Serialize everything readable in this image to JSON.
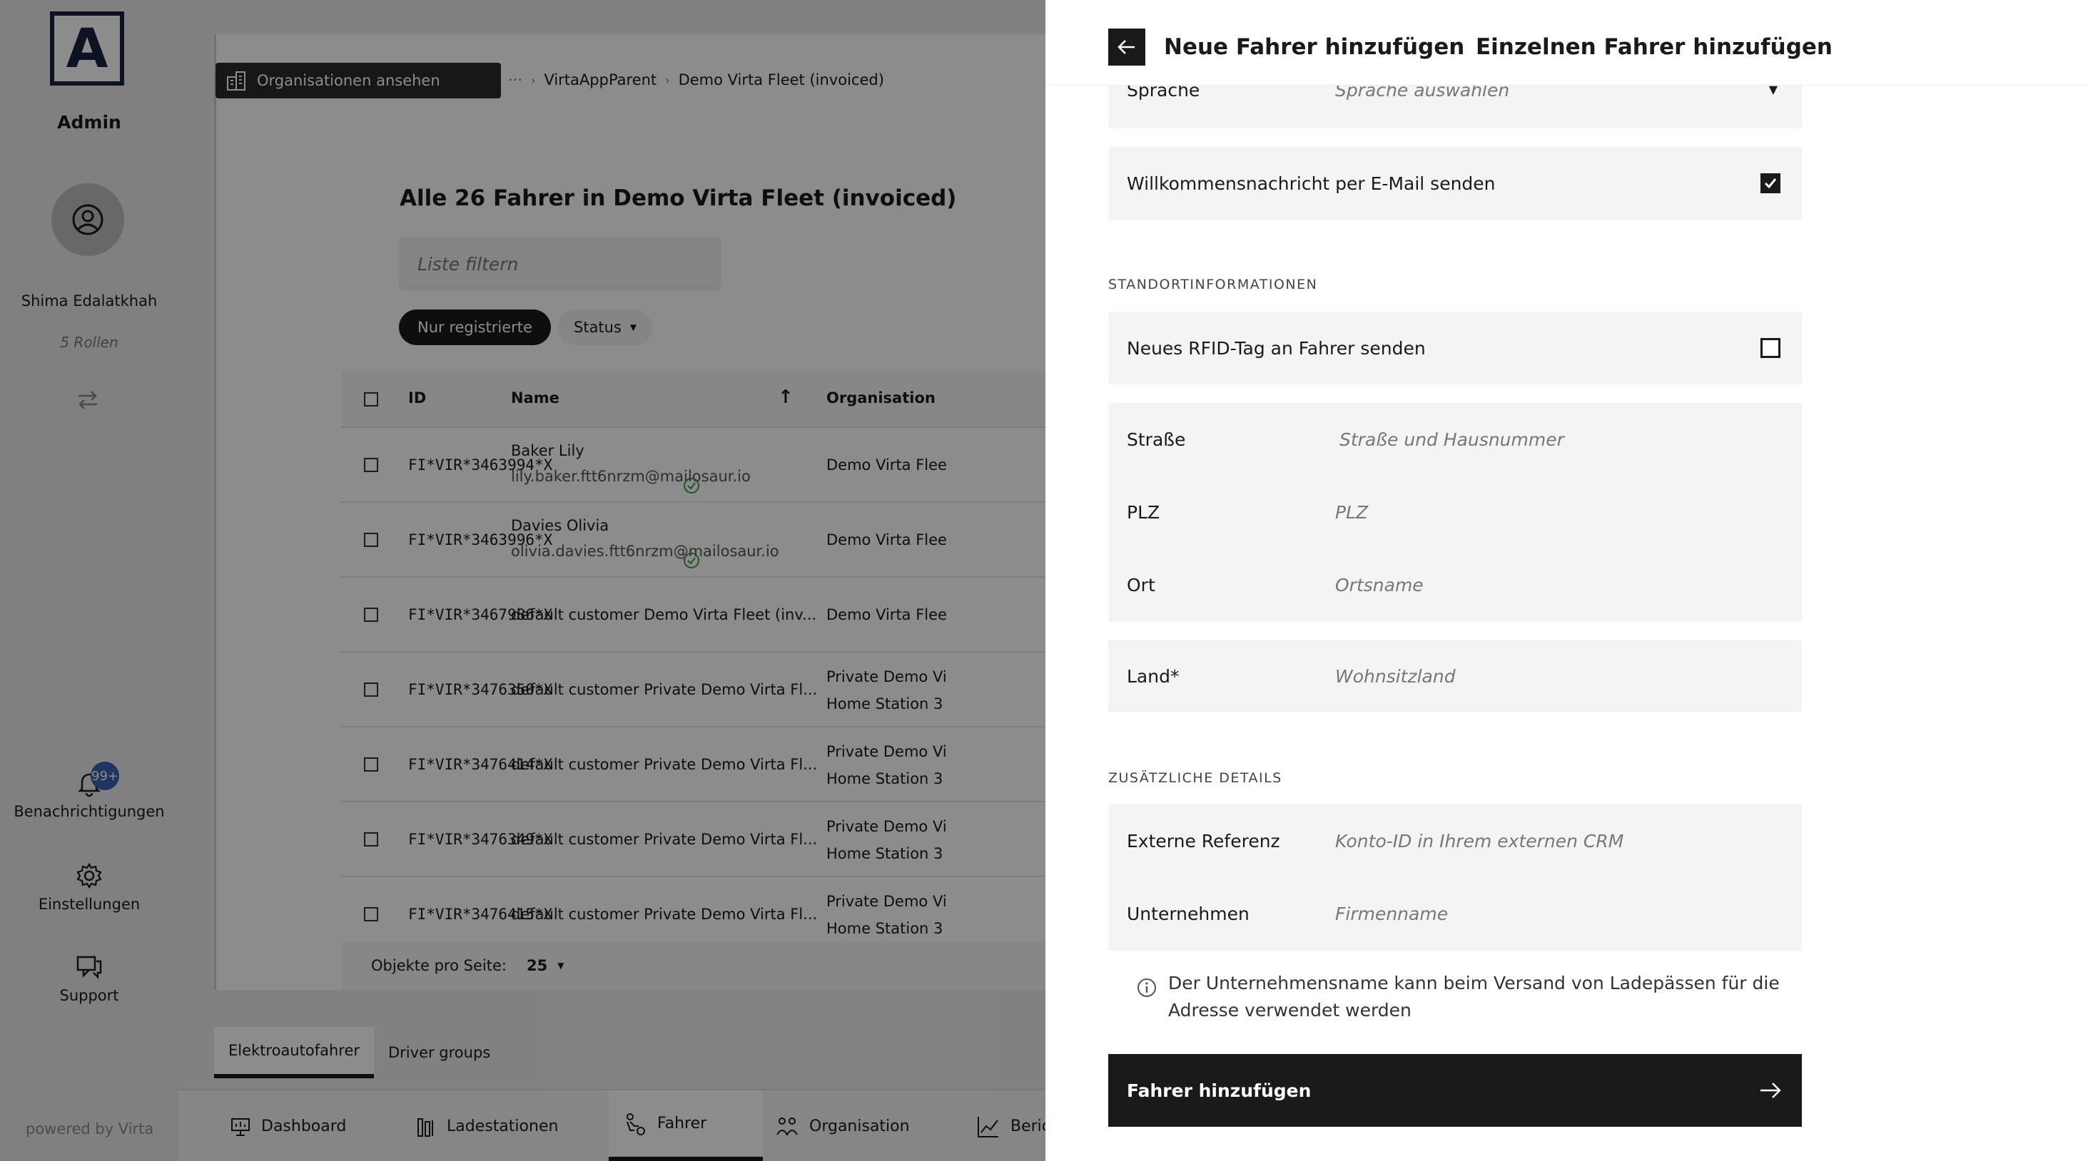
{
  "sidebar": {
    "logo_letter": "A",
    "admin_label": "Admin",
    "user_name": "Shima Edalatkhah",
    "roles": "5 Rollen",
    "notifications": {
      "label": "Benachrichtigungen",
      "badge": "99+"
    },
    "settings_label": "Einstellungen",
    "support_label": "Support",
    "powered_by": "powered by Virta"
  },
  "main": {
    "org_button": "Organisationen ansehen",
    "breadcrumb": {
      "ellipsis": "···",
      "parent": "VirtaAppParent",
      "current": "Demo Virta Fleet (invoiced)"
    },
    "list_title": "Alle 26 Fahrer in Demo Virta Fleet (invoiced)",
    "filter_placeholder": "Liste filtern",
    "filter_chip": "Nur registrierte",
    "status_chip": "Status",
    "columns": {
      "id": "ID",
      "name": "Name",
      "org": "Organisation"
    },
    "rows": [
      {
        "id": "FI*VIR*3463994*X",
        "name": "Baker Lily",
        "email": "lily.baker.ftt6nrzm@mailosaur.io",
        "org": "Demo Virta Flee",
        "org2": ""
      },
      {
        "id": "FI*VIR*3463996*X",
        "name": "Davies Olivia",
        "email": "olivia.davies.ftt6nrzm@mailosaur.io",
        "org": "Demo Virta Flee",
        "org2": ""
      },
      {
        "id": "FI*VIR*3467986*X",
        "name": "default customer Demo Virta Fleet (inv...",
        "email": "",
        "org": "Demo Virta Flee",
        "org2": ""
      },
      {
        "id": "FI*VIR*3476350*X",
        "name": "default customer Private Demo Virta Fl...",
        "email": "",
        "org": "Private Demo Vi",
        "org2": "Home Station 3"
      },
      {
        "id": "FI*VIR*3476414*X",
        "name": "default customer Private Demo Virta Fl...",
        "email": "",
        "org": "Private Demo Vi",
        "org2": "Home Station 3"
      },
      {
        "id": "FI*VIR*3476349*X",
        "name": "default customer Private Demo Virta Fl...",
        "email": "",
        "org": "Private Demo Vi",
        "org2": "Home Station 3"
      },
      {
        "id": "FI*VIR*3476415*X",
        "name": "default customer Private Demo Virta Fl...",
        "email": "",
        "org": "Private Demo Vi",
        "org2": "Home Station 3"
      }
    ],
    "pager": {
      "label": "Objekte pro Seite:",
      "value": "25"
    },
    "subtabs": [
      "Elektroautofahrer",
      "Driver groups"
    ],
    "bottom_nav": [
      "Dashboard",
      "Ladestationen",
      "Fahrer",
      "Organisation",
      "Beric"
    ]
  },
  "drawer": {
    "title": "Neue Fahrer hinzufügen",
    "subtitle": "Einzelnen Fahrer hinzufügen",
    "language": {
      "label": "Sprache",
      "placeholder": "Sprache auswählen"
    },
    "welcome": {
      "label": "Willkommensnachricht per E-Mail senden",
      "checked": true
    },
    "location_heading": "STANDORTINFORMATIONEN",
    "rfid": {
      "label": "Neues RFID-Tag an Fahrer senden",
      "checked": false
    },
    "street": {
      "label": "Straße",
      "placeholder": "Straße und Hausnummer"
    },
    "zip": {
      "label": "PLZ",
      "placeholder": "PLZ"
    },
    "city": {
      "label": "Ort",
      "placeholder": "Ortsname"
    },
    "country": {
      "label": "Land*",
      "placeholder": "Wohnsitzland"
    },
    "extra_heading": "ZUSÄTZLICHE DETAILS",
    "external_ref": {
      "label": "Externe Referenz",
      "placeholder": "Konto-ID in Ihrem externen CRM"
    },
    "company": {
      "label": "Unternehmen",
      "placeholder": "Firmenname"
    },
    "company_hint_line1": "Der Unternehmensname kann beim Versand von Ladepässen für die",
    "company_hint_line2": "Adresse verwendet werden",
    "submit_label": "Fahrer hinzufügen"
  },
  "colors": {
    "accent_dark": "#1a1a1a",
    "badge_blue": "#3a5fb0",
    "success_green": "#3a9a4a",
    "overlay": "rgba(0,0,0,0.45)"
  }
}
